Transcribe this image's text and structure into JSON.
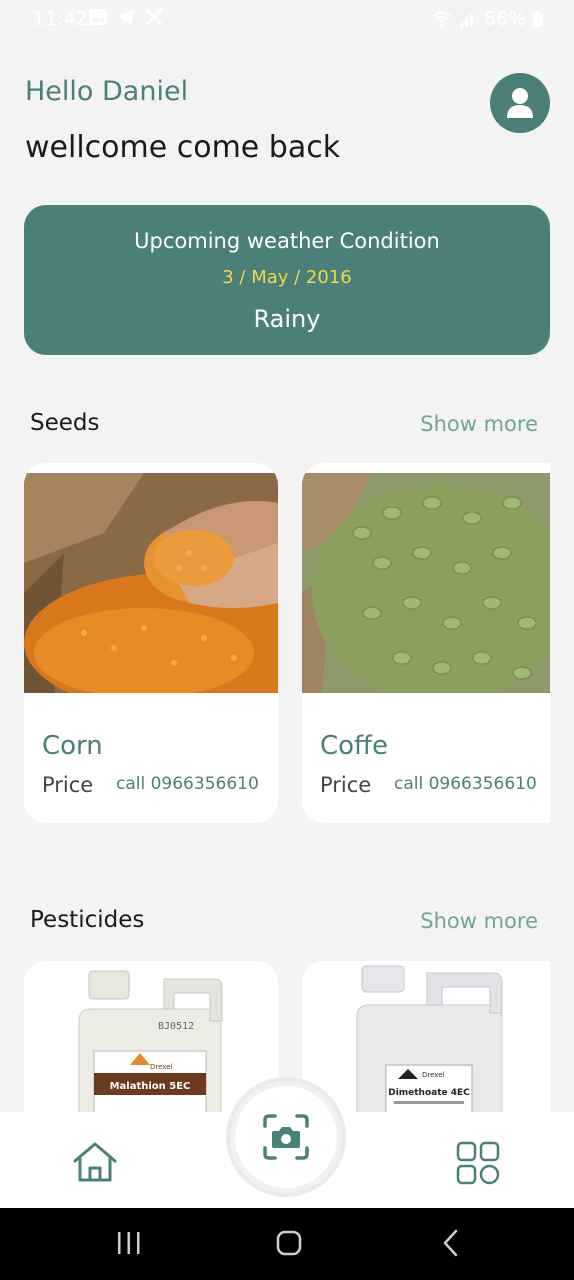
{
  "status_bar": {
    "time": "11:42",
    "battery": "66%",
    "icons": [
      "gallery-icon",
      "telegram-icon",
      "x-icon",
      "wifi-icon",
      "signal-icon",
      "battery-icon"
    ]
  },
  "header": {
    "greeting": "Hello Daniel",
    "welcome": "wellcome come back",
    "avatar_icon": "user-icon"
  },
  "weather": {
    "title": "Upcoming weather Condition",
    "date": "3 / May / 2016",
    "condition": "Rainy"
  },
  "seeds": {
    "title": "Seeds",
    "show_more": "Show more",
    "items": [
      {
        "name": "Corn",
        "price_label": "Price",
        "phone": "call 0966356610"
      },
      {
        "name": "Coffe",
        "price_label": "Price",
        "phone": "call 0966356610"
      }
    ]
  },
  "pesticides": {
    "title": "Pesticides",
    "show_more": "Show more",
    "items": [
      {
        "brand": "Drexel",
        "product": "Malathion 5EC",
        "code": "BJ0512"
      },
      {
        "brand": "Drexel",
        "product": "Dimethoate 4EC"
      }
    ]
  },
  "bottom_nav": {
    "items": [
      "home-icon",
      "camera-scan-icon",
      "grid-icon"
    ]
  },
  "colors": {
    "primary": "#4a8078",
    "accent_date": "#f2d64b",
    "show_more": "#6ea59b",
    "background": "#f3f3f3"
  }
}
